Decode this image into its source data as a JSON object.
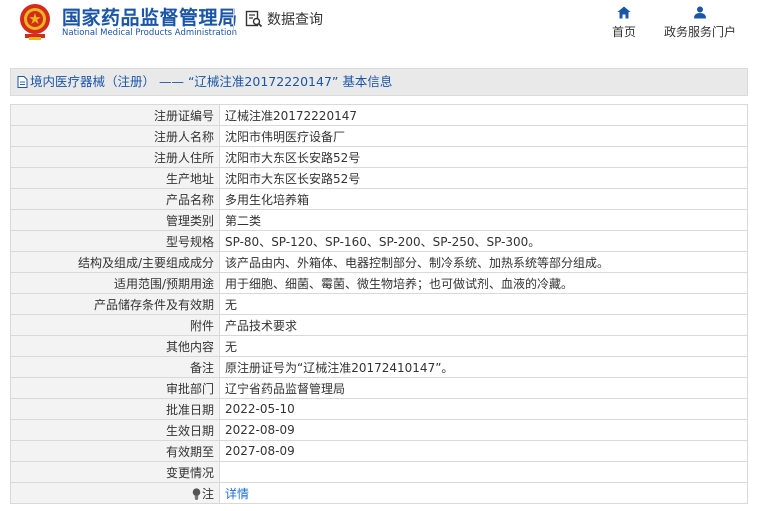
{
  "header": {
    "brand_cn": "国家药品监督管理局",
    "brand_en": "National Medical Products Administration",
    "db_query": "数据查询",
    "nav": [
      {
        "label": "首页",
        "icon": "home-icon"
      },
      {
        "label": "政务服务门户",
        "icon": "user-icon"
      }
    ]
  },
  "breadcrumb": {
    "text": "境内医疗器械（注册） —— “辽械注准20172220147” 基本信息"
  },
  "details": [
    {
      "key": "注册证编号",
      "value": "辽械注准20172220147"
    },
    {
      "key": "注册人名称",
      "value": "沈阳市伟明医疗设备厂"
    },
    {
      "key": "注册人住所",
      "value": "沈阳市大东区长安路52号"
    },
    {
      "key": "生产地址",
      "value": "沈阳市大东区长安路52号"
    },
    {
      "key": "产品名称",
      "value": "多用生化培养箱"
    },
    {
      "key": "管理类别",
      "value": "第二类"
    },
    {
      "key": "型号规格",
      "value": "SP-80、SP-120、SP-160、SP-200、SP-250、SP-300。"
    },
    {
      "key": "结构及组成/主要组成成分",
      "value": "该产品由内、外箱体、电器控制部分、制冷系统、加热系统等部分组成。"
    },
    {
      "key": "适用范围/预期用途",
      "value": "用于细胞、细菌、霉菌、微生物培养；也可做试剂、血液的冷藏。"
    },
    {
      "key": "产品储存条件及有效期",
      "value": "无"
    },
    {
      "key": "附件",
      "value": "产品技术要求"
    },
    {
      "key": "其他内容",
      "value": "无"
    },
    {
      "key": "备注",
      "value": "原注册证号为“辽械注准20172410147”。"
    },
    {
      "key": "审批部门",
      "value": "辽宁省药品监督管理局"
    },
    {
      "key": "批准日期",
      "value": "2022-05-10"
    },
    {
      "key": "生效日期",
      "value": "2022-08-09"
    },
    {
      "key": "有效期至",
      "value": "2027-08-09"
    },
    {
      "key": "变更情况",
      "value": ""
    }
  ],
  "note_row": {
    "key": "注",
    "link": "详情"
  },
  "colors": {
    "brand_blue": "#1a55a8",
    "link_blue": "#1a6ed8",
    "emblem_red": "#d52b1e"
  }
}
